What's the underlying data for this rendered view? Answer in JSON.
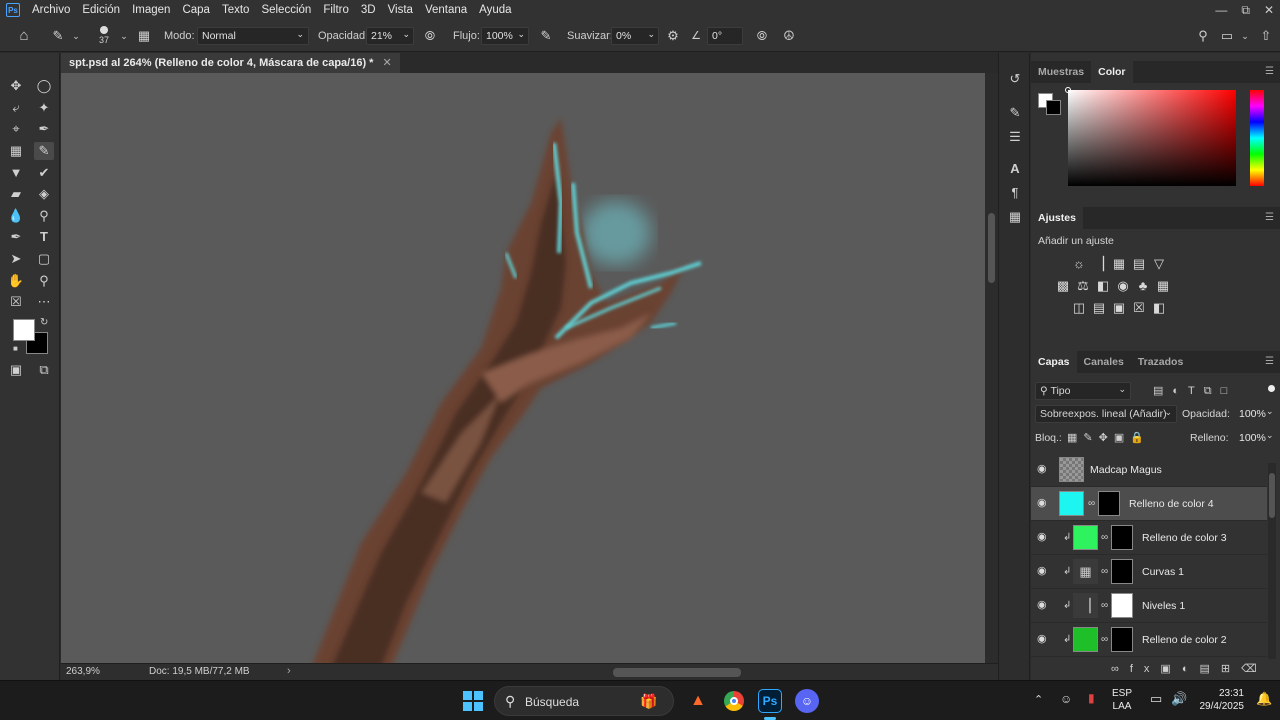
{
  "app": {
    "logo": "Ps"
  },
  "menu": [
    "Archivo",
    "Edición",
    "Imagen",
    "Capa",
    "Texto",
    "Selección",
    "Filtro",
    "3D",
    "Vista",
    "Ventana",
    "Ayuda"
  ],
  "options": {
    "brush_size": "37",
    "mode_label": "Modo:",
    "mode_value": "Normal",
    "opacity_label": "Opacidad:",
    "opacity_value": "21%",
    "flow_label": "Flujo:",
    "flow_value": "100%",
    "smoothing_label": "Suavizar:",
    "smoothing_value": "0%",
    "angle_value": "0°"
  },
  "document": {
    "tab_title": "spt.psd al 264% (Relleno de color 4, Máscara de capa/16) *",
    "zoom": "263,9%",
    "doc_size": "Doc: 19,5 MB/77,2 MB"
  },
  "color_panel": {
    "tabs": [
      "Muestras",
      "Color"
    ],
    "active_tab": "Color",
    "foreground": "#ffffff",
    "background": "#000000",
    "hue_color": "#ff0000"
  },
  "adjustments": {
    "title": "Ajustes",
    "subtitle": "Añadir un ajuste"
  },
  "layers_panel": {
    "tabs": [
      "Capas",
      "Canales",
      "Trazados"
    ],
    "filter_label": "Tipo",
    "blend_mode": "Sobreexpos. lineal (Añadir)",
    "opacity_label": "Opacidad:",
    "opacity_value": "100%",
    "lock_label": "Bloq.:",
    "fill_label": "Relleno:",
    "fill_value": "100%",
    "layers": [
      {
        "name": "Madcap Magus",
        "thumb_color": "#7a7a7a",
        "has_mask": false,
        "clipped": false,
        "selected": false
      },
      {
        "name": "Relleno de color 4",
        "thumb_color": "#1ef5f0",
        "has_mask": true,
        "clipped": false,
        "selected": true
      },
      {
        "name": "Relleno de color 3",
        "thumb_color": "#2ef25e",
        "has_mask": true,
        "clipped": true,
        "selected": false
      },
      {
        "name": "Curvas 1",
        "thumb_color": "#3a3a3a",
        "has_mask": true,
        "clipped": true,
        "selected": false
      },
      {
        "name": "Niveles 1",
        "thumb_color": "#3a3a3a",
        "has_mask": true,
        "clipped": true,
        "selected": false
      },
      {
        "name": "Relleno de color 2",
        "thumb_color": "#1fbf2a",
        "has_mask": true,
        "clipped": true,
        "selected": false
      }
    ]
  },
  "taskbar": {
    "search_placeholder": "Búsqueda",
    "lang_top": "ESP",
    "lang_bottom": "LAA",
    "time": "23:31",
    "date": "29/4/2025"
  },
  "colors": {
    "canvas_bg": "#5a5a5a",
    "stroke_brown": "#6b4030",
    "glow_cyan": "#5fd3d8"
  }
}
